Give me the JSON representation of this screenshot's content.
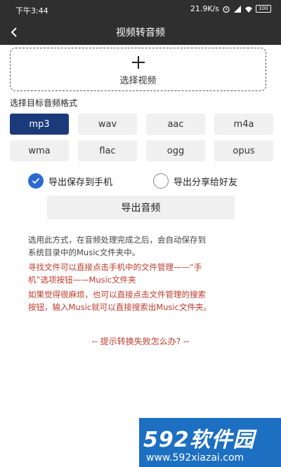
{
  "status_bar": {
    "time": "下午3:44",
    "speed": "21.9K/s",
    "battery": "100"
  },
  "nav": {
    "title": "视频转音频"
  },
  "select_video": {
    "label": "选择视频"
  },
  "format_section": {
    "label": "选择目标音频格式",
    "formats": [
      "mp3",
      "wav",
      "aac",
      "m4a",
      "wma",
      "flac",
      "ogg",
      "opus"
    ],
    "selected": "mp3"
  },
  "export_options": {
    "save_to_phone": "导出保存到手机",
    "share_to_friend": "导出分享给好友",
    "selected": "save_to_phone"
  },
  "export_button": "导出音频",
  "info": {
    "line1a": "选用此方式，在音频处理完成之后，会自动保存到",
    "line1b": "系统目录中的Music文件夹中。",
    "line2a": "寻找文件可以直接点击手机中的文件管理——“手",
    "line2b": "机”选项按钮——Music文件夹",
    "line3a": "如果觉得很麻烦，也可以直接点击文件管理的搜索",
    "line3b": "按钮，输入Music就可以直接搜索出Music文件夹。"
  },
  "help_link": "-- 提示转换失败怎么办? --",
  "watermark": {
    "logo": "592软件园",
    "url": "www.592xiazai.com"
  },
  "colors": {
    "accent": "#1a3a7a",
    "check": "#2b6ad6",
    "warning": "#c0392b",
    "bar": "#2f2f2f"
  }
}
